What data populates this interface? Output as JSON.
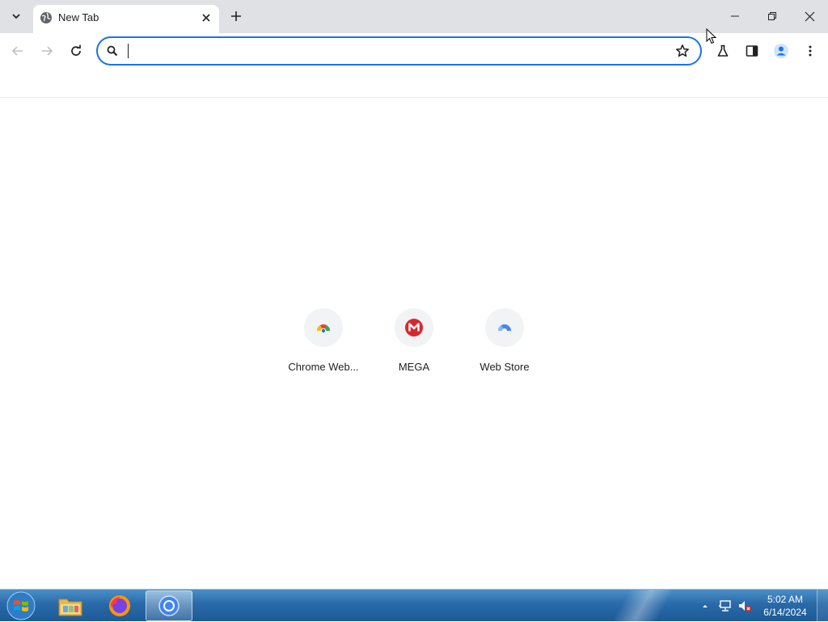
{
  "browser": {
    "tab": {
      "title": "New Tab"
    },
    "omnibox": {
      "value": "",
      "placeholder": ""
    },
    "window_controls": {
      "minimize": "minimize",
      "restore": "restore",
      "close": "close"
    }
  },
  "shortcuts": [
    {
      "label": "Chrome Web...",
      "icon": "chrome-web-store-icon"
    },
    {
      "label": "MEGA",
      "icon": "mega-icon",
      "color": "#d9272e"
    },
    {
      "label": "Web Store",
      "icon": "web-store-icon"
    }
  ],
  "taskbar": {
    "apps": [
      "file-explorer",
      "firefox",
      "chrome"
    ],
    "active_app": "chrome",
    "clock": {
      "time": "5:02 AM",
      "date": "6/14/2024"
    }
  },
  "colors": {
    "accent": "#1a73e8",
    "tabstrip": "#dfe1e5",
    "taskbar": "#2a6aa8"
  }
}
